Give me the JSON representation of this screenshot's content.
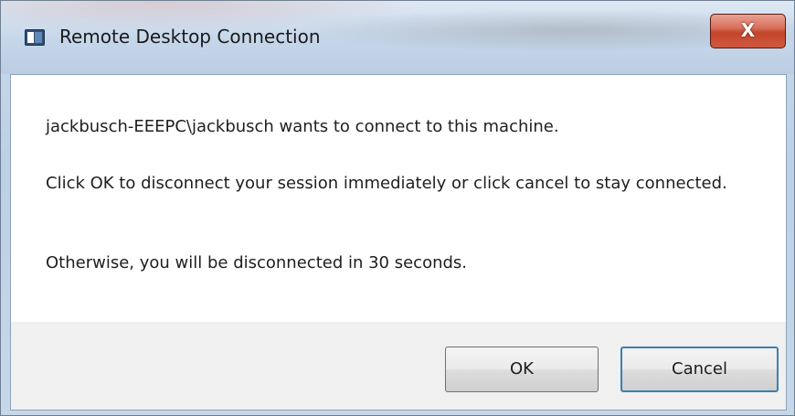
{
  "window": {
    "title": "Remote Desktop Connection",
    "close_label": "X"
  },
  "message": {
    "line1": "jackbusch-EEEPC\\jackbusch wants to connect to this machine.",
    "line2": "Click OK to disconnect your session immediately or click cancel to stay connected.",
    "line3": "Otherwise, you will be disconnected in 30 seconds."
  },
  "buttons": {
    "ok_label": "OK",
    "cancel_label": "Cancel"
  },
  "icons": {
    "app": "remote-desktop-icon",
    "close": "close-icon"
  },
  "colors": {
    "close_button": "#c3452b",
    "focus_border": "#3c7fb1"
  }
}
